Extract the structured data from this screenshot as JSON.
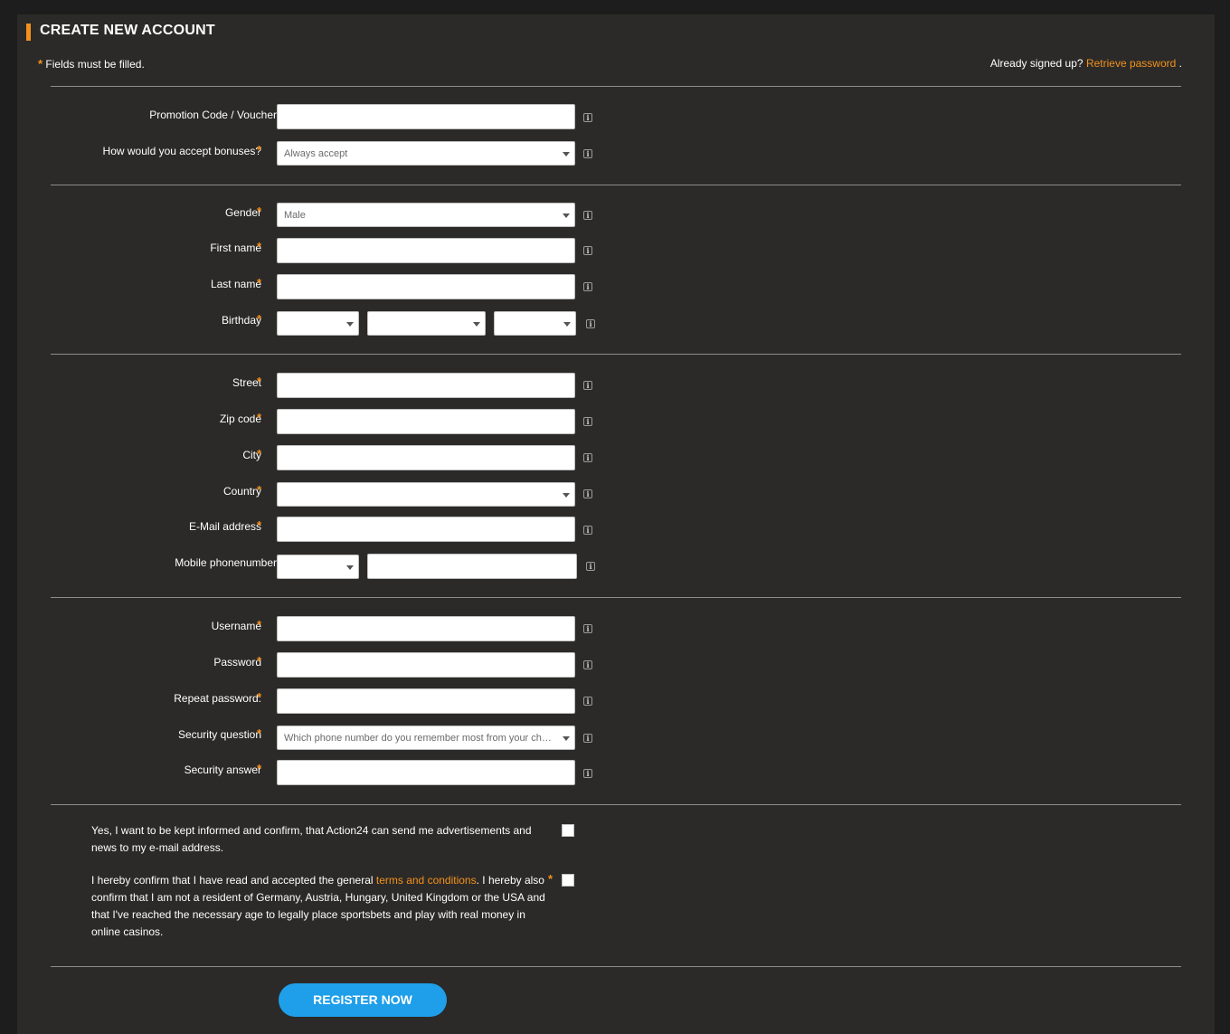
{
  "header": {
    "title": "CREATE NEW ACCOUNT",
    "required_star": "*",
    "required_note": "Fields must be filled.",
    "signed_up_text": "Already signed up?",
    "retrieve_link": "Retrieve password",
    "signed_up_suffix": "."
  },
  "info_glyph": "i",
  "star": "*",
  "bonus": {
    "promo_label": "Promotion Code / Voucher",
    "accept_label": "How would you accept bonuses?",
    "accept_value": "Always accept"
  },
  "personal": {
    "gender_label": "Gender",
    "gender_value": "Male",
    "first_name_label": "First name",
    "last_name_label": "Last name",
    "birthday_label": "Birthday"
  },
  "address": {
    "street_label": "Street",
    "zip_label": "Zip code",
    "city_label": "City",
    "country_label": "Country",
    "email_label": "E-Mail address",
    "mobile_label": "Mobile phonenumber"
  },
  "account": {
    "username_label": "Username",
    "password_label": "Password",
    "repeat_label": "Repeat password:",
    "question_label": "Security question",
    "question_value": "Which phone number do you remember most from your childhood?",
    "answer_label": "Security answer"
  },
  "consent": {
    "newsletter_text": "Yes, I want to be kept informed and confirm, that Action24 can send me advertisements and news to my e-mail address.",
    "terms_prefix": "I hereby confirm that I have read and accepted the general ",
    "terms_link": "terms and conditions",
    "terms_suffix": ". I hereby also confirm that I am not a resident of Germany, Austria, Hungary, United Kingdom or the USA and that I've reached the necessary age to legally place sportsbets and play with real money in online casinos."
  },
  "register_label": "REGISTER NOW",
  "colors": {
    "accent": "#f3911c",
    "button": "#1f9fe9",
    "panel": "#2b2a28",
    "background": "#1d1d1d"
  }
}
